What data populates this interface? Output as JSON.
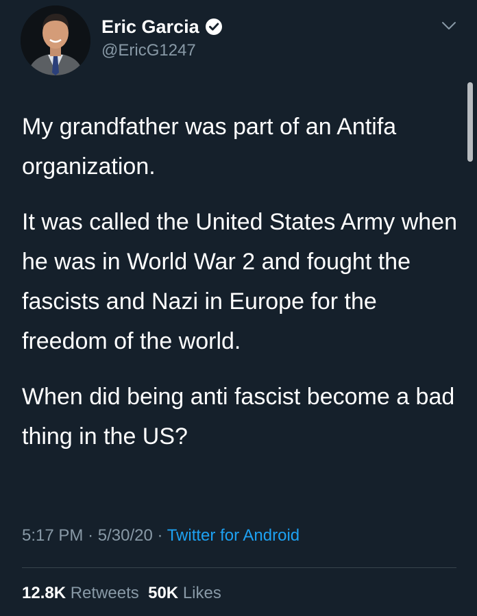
{
  "author": {
    "name": "Eric Garcia",
    "handle": "@EricG1247",
    "verified": true
  },
  "tweet": {
    "paragraphs": [
      "My grandfather was part of an Antifa organization.",
      "It was called the United States Army when he was in World War 2 and fought the fascists and Nazi in Europe for the freedom of the world.",
      "When did being anti fascist become a bad thing in the US?"
    ],
    "time": "5:17 PM",
    "date": "5/30/20",
    "separator": "·",
    "source": "Twitter for Android"
  },
  "stats": {
    "retweets_count": "12.8K",
    "retweets_label": "Retweets",
    "likes_count": "50K",
    "likes_label": "Likes"
  },
  "icons": {
    "verified": "verified-badge-icon",
    "more": "chevron-down-icon"
  },
  "colors": {
    "background": "#15202b",
    "text_primary": "#ffffff",
    "text_secondary": "#8899a6",
    "link": "#1da1f2",
    "divider": "#38444d"
  }
}
